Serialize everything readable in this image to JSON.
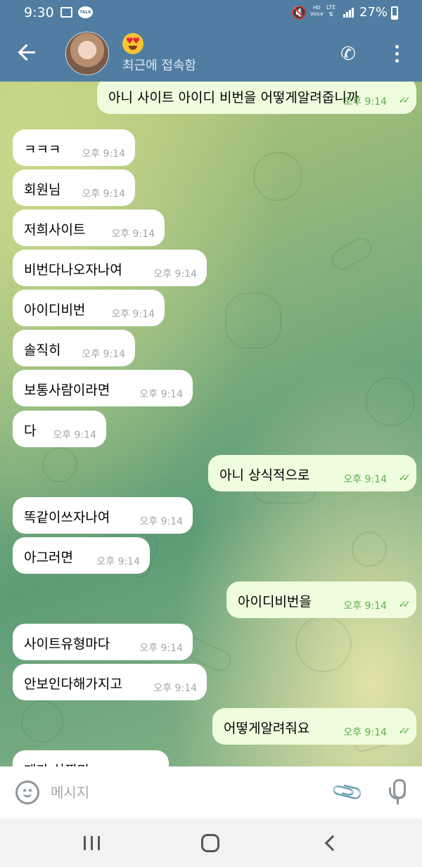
{
  "status_bar": {
    "time": "9:30",
    "battery": "27%",
    "hd_label": "HD",
    "voice_label": "Voice",
    "lte_label": "LTE",
    "talk_label": "TALK"
  },
  "header": {
    "subtitle": "최근에 접속함",
    "emoji": "smiling-face-with-heart-eyes"
  },
  "messages": [
    {
      "dir": "out",
      "text": "아니 사이트 아이디 비번을 어떻게알려줍니까",
      "time": "오후 9:14",
      "read": true
    },
    {
      "dir": "in",
      "text": "ㅋㅋㅋ",
      "time": "오후 9:14"
    },
    {
      "dir": "in",
      "text": "회원님",
      "time": "오후 9:14"
    },
    {
      "dir": "in",
      "text": "저희사이트",
      "time": "오후 9:14"
    },
    {
      "dir": "in",
      "text": "비번다나오자나여",
      "time": "오후 9:14"
    },
    {
      "dir": "in",
      "text": "아이디비번",
      "time": "오후 9:14"
    },
    {
      "dir": "in",
      "text": "솔직히",
      "time": "오후 9:14"
    },
    {
      "dir": "in",
      "text": "보통사람이라면",
      "time": "오후 9:14"
    },
    {
      "dir": "in",
      "text": "다",
      "time": "오후 9:14"
    },
    {
      "dir": "out",
      "text": "아니 상식적으로",
      "time": "오후 9:14",
      "read": true
    },
    {
      "dir": "in",
      "text": "똑같이쓰자나여",
      "time": "오후 9:14"
    },
    {
      "dir": "in",
      "text": "아그러면",
      "time": "오후 9:14"
    },
    {
      "dir": "out",
      "text": "아이디비번을",
      "time": "오후 9:14",
      "read": true
    },
    {
      "dir": "in",
      "text": "사이트유형마다",
      "time": "오후 9:14"
    },
    {
      "dir": "in",
      "text": "안보인다해가지고",
      "time": "오후 9:14"
    },
    {
      "dir": "out",
      "text": "어떻게알려줘요",
      "time": "오후 9:14",
      "read": true
    },
    {
      "dir": "in",
      "text": "제가 살짝만",
      "time": ""
    }
  ],
  "composer": {
    "placeholder": "메시지"
  },
  "icons": {
    "back": "back-arrow-icon",
    "call": "phone-icon",
    "menu": "more-vertical-icon",
    "emoji": "emoji-icon",
    "attach": "paperclip-icon",
    "mic": "microphone-icon"
  },
  "colors": {
    "header": "#517da2",
    "outgoing_bubble": "#effdde",
    "incoming_bubble": "#ffffff",
    "read_check": "#5fae4e"
  }
}
